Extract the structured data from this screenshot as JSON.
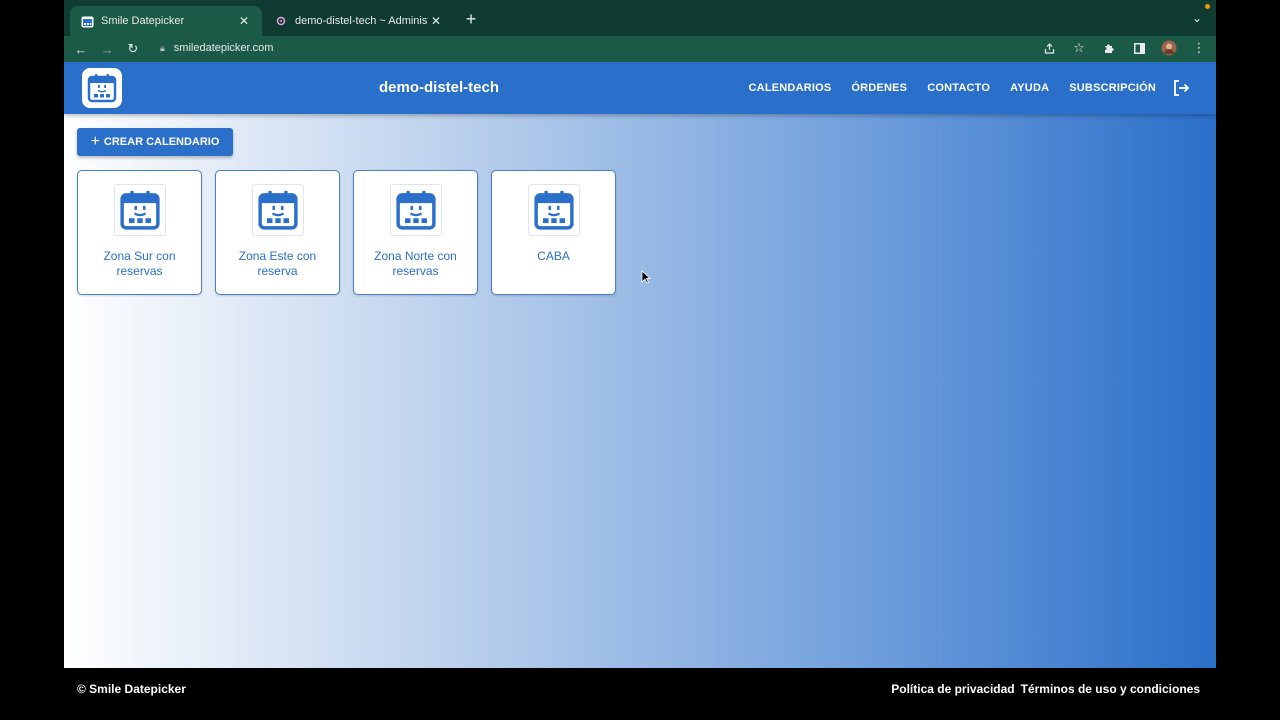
{
  "browser": {
    "tabs": [
      {
        "title": "Smile Datepicker",
        "favicon": "smile-calendar-icon",
        "active": true
      },
      {
        "title": "demo-distel-tech ~ Administra",
        "favicon": "admin-icon",
        "active": false
      }
    ],
    "url": "smiledatepicker.com"
  },
  "app": {
    "title": "demo-distel-tech",
    "nav": [
      "CALENDARIOS",
      "ÓRDENES",
      "CONTACTO",
      "AYUDA",
      "SUBSCRIPCIÓN"
    ],
    "primary_color": "#2a6fc9"
  },
  "actions": {
    "create_label": "CREAR CALENDARIO"
  },
  "calendars": [
    {
      "name": "Zona Sur con reservas"
    },
    {
      "name": "Zona Este con reserva"
    },
    {
      "name": "Zona Norte con reservas"
    },
    {
      "name": "CABA"
    }
  ],
  "footer": {
    "copyright": "© Smile Datepicker",
    "links": [
      "Política de privacidad",
      "Términos de uso y condiciones"
    ]
  }
}
